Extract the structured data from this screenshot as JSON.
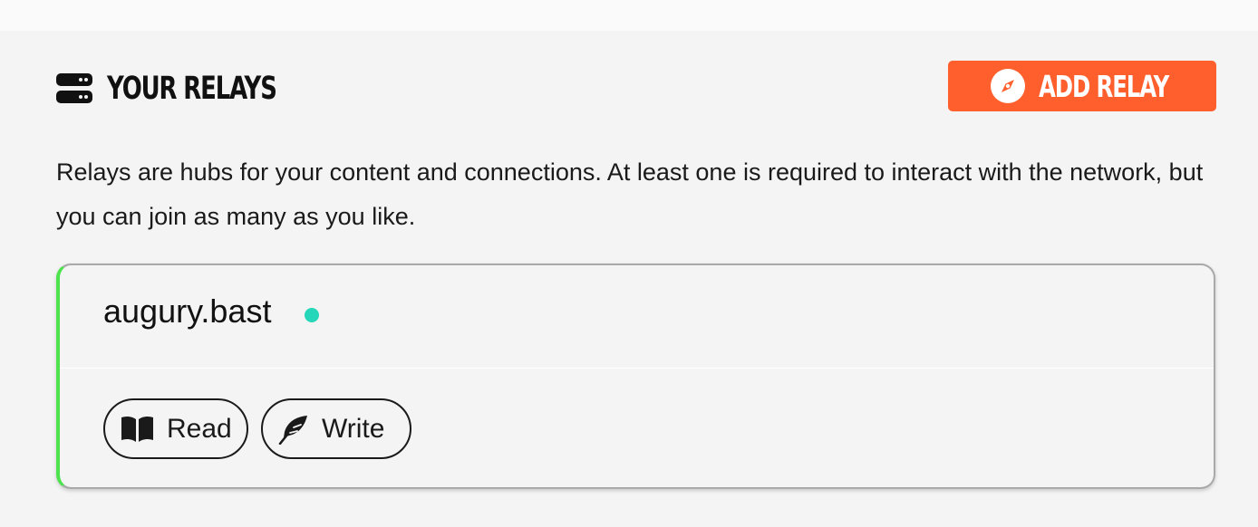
{
  "section": {
    "title": "YOUR RELAYS",
    "title_icon": "server-icon",
    "add_button": {
      "label": "ADD RELAY",
      "icon": "compass-icon"
    },
    "description": "Relays are hubs for your content and connections. At least one is required to interact with the network, but you can join as many as you like."
  },
  "relays": [
    {
      "name": "augury.bast",
      "status_color": "#25d6b8",
      "accent_color": "#4ce34c",
      "permissions": [
        {
          "label": "Read",
          "icon": "book-icon"
        },
        {
          "label": "Write",
          "icon": "feather-icon"
        }
      ]
    }
  ],
  "colors": {
    "accent": "#ff5f2c",
    "background": "#f4f4f4",
    "status_online": "#25d6b8",
    "card_accent": "#4ce34c"
  }
}
